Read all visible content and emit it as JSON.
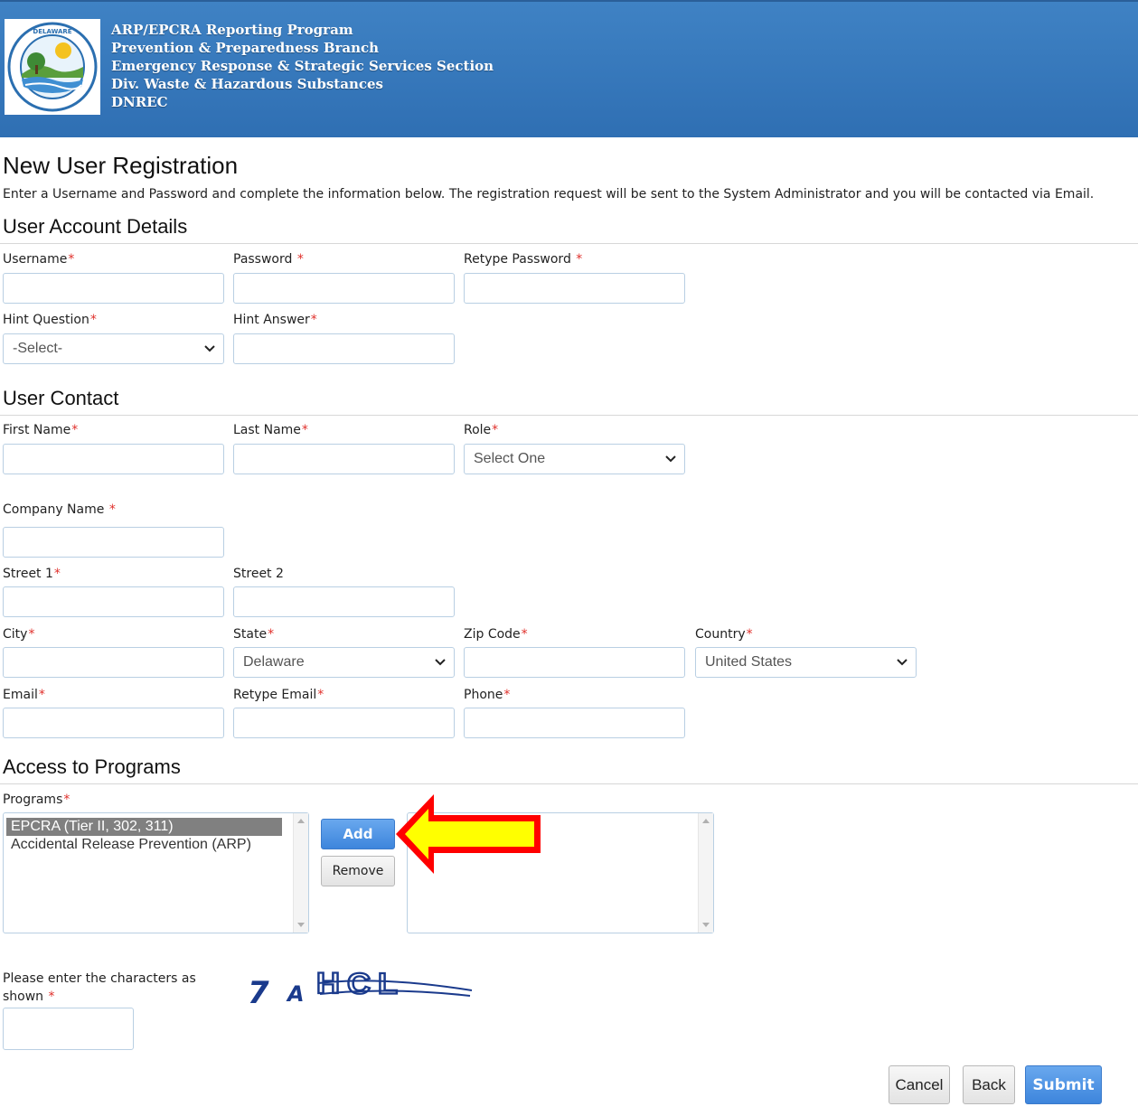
{
  "header": {
    "lines": [
      "ARP/EPCRA Reporting Program",
      "Prevention & Preparedness Branch",
      "Emergency Response & Strategic Services Section",
      "Div. Waste & Hazardous Substances",
      "DNREC"
    ],
    "logo_text_top": "DELAWARE"
  },
  "page": {
    "title": "New User Registration",
    "intro": "Enter a Username and Password and complete the information below. The registration request will be sent to the System Administrator and you will be contacted via Email."
  },
  "account": {
    "title": "User Account Details",
    "username_label": "Username",
    "password_label": "Password ",
    "retype_password_label": "Retype Password ",
    "hint_question_label": "Hint Question",
    "hint_question_value": "-Select-",
    "hint_answer_label": "Hint Answer"
  },
  "contact": {
    "title": "User Contact",
    "first_name_label": "First Name",
    "last_name_label": "Last Name",
    "role_label": "Role",
    "role_value": "Select One",
    "company_label": "Company Name ",
    "street1_label": "Street 1",
    "street2_label": "Street 2",
    "city_label": "City",
    "state_label": "State",
    "state_value": "Delaware",
    "zip_label": "Zip Code",
    "country_label": "Country",
    "country_value": "United States",
    "email_label": "Email",
    "retype_email_label": "Retype Email",
    "phone_label": "Phone"
  },
  "programs": {
    "title": "Access to Programs",
    "label": "Programs",
    "available": [
      "EPCRA (Tier II, 302, 311)",
      "Accidental Release Prevention (ARP)"
    ],
    "add_label": "Add",
    "remove_label": "Remove"
  },
  "captcha": {
    "label": "Please enter the characters as shown ",
    "text": "7AHCL"
  },
  "actions": {
    "cancel_label": "Cancel",
    "back_label": "Back",
    "submit_label": "Submit"
  },
  "required_marker": "*",
  "colors": {
    "header_blue": "#3f82c4",
    "required_red": "#e0302b",
    "button_blue": "#4a8fe2",
    "arrow_fill": "#ffff00",
    "arrow_stroke": "#ff0000"
  }
}
